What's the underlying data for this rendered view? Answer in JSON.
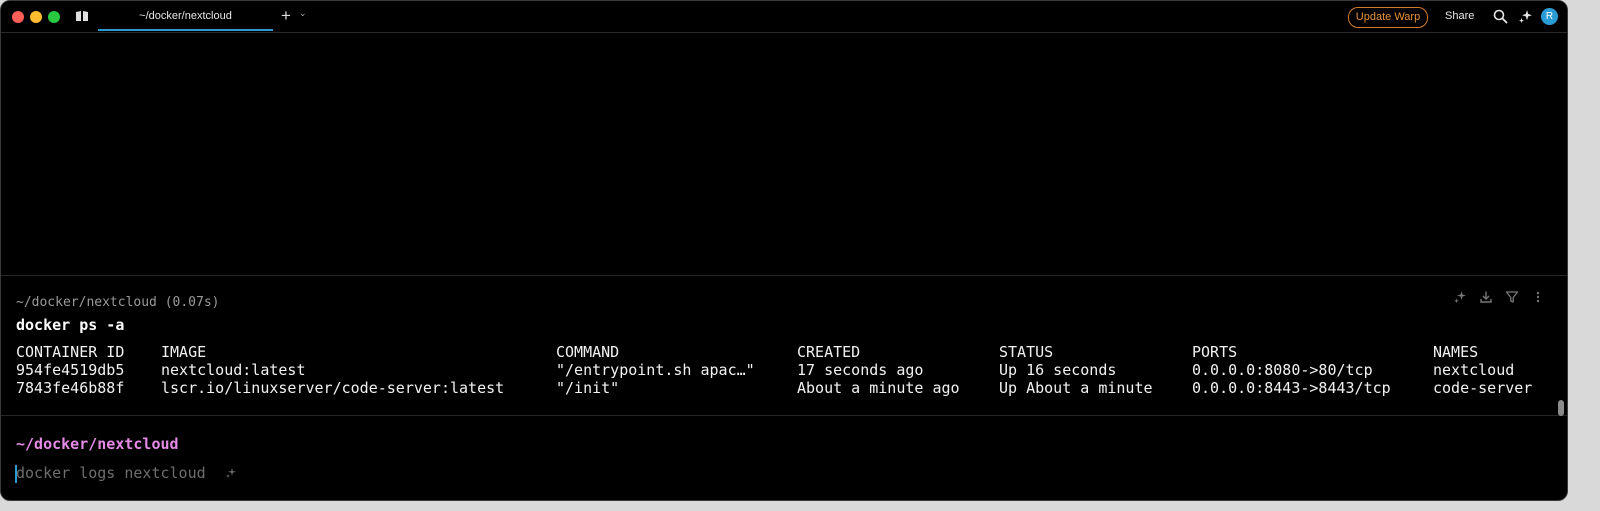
{
  "titlebar": {
    "tab_title": "~/docker/nextcloud",
    "new_tab_symbol": "+",
    "tab_menu_symbol": "⌄",
    "update_label": "Update Warp",
    "share_label": "Share",
    "avatar_initial": "R"
  },
  "block": {
    "header": "~/docker/nextcloud (0.07s)",
    "command": "docker ps -a",
    "columns": [
      "CONTAINER ID",
      "IMAGE",
      "COMMAND",
      "CREATED",
      "STATUS",
      "PORTS",
      "NAMES"
    ],
    "rows": [
      [
        "954fe4519db5",
        "nextcloud:latest",
        "\"/entrypoint.sh apac…\"",
        "17 seconds ago",
        "Up 16 seconds",
        "0.0.0.0:8080->80/tcp",
        "nextcloud"
      ],
      [
        "7843fe46b88f",
        "lscr.io/linuxserver/code-server:latest",
        "\"/init\"",
        "About a minute ago",
        "Up About a minute",
        "0.0.0.0:8443->8443/tcp",
        "code-server"
      ]
    ]
  },
  "prompt": {
    "directory": "~/docker/nextcloud",
    "autosuggestion": "docker logs nextcloud"
  },
  "colors": {
    "accent": "#2b9bd6",
    "prompt_dir": "#e58ae6",
    "update_orange": "#e8913a"
  }
}
